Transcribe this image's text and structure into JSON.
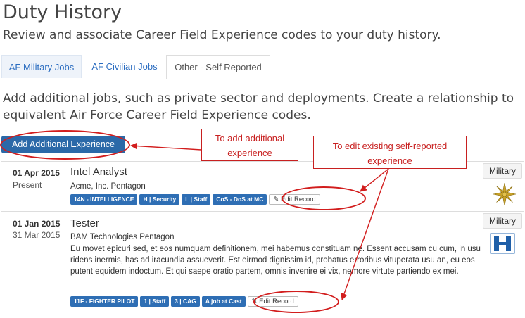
{
  "page": {
    "title": "Duty History",
    "subtitle": "Review and associate Career Field Experience codes to your duty history."
  },
  "tabs": [
    {
      "label": "AF Military Jobs"
    },
    {
      "label": "AF Civilian Jobs"
    },
    {
      "label": "Other - Self Reported"
    }
  ],
  "intro": "Add additional jobs, such as private sector and deployments. Create a relationship to equivalent Air Force Career Field Experience codes.",
  "add_button": "Add Additional Experience",
  "annotations": {
    "add_callout": "To add additional experience",
    "edit_callout": "To edit existing self-reported experience"
  },
  "records": [
    {
      "start": "01 Apr 2015",
      "end": "Present",
      "title": "Intel Analyst",
      "org": "Acme, Inc. Pentagon",
      "description": "",
      "tags": [
        "14N - INTELLIGENCE",
        "H | Security",
        "L | Staff",
        "CoS - DoS at MC"
      ],
      "edit_label": "Edit Record",
      "badge": "Military",
      "icon": "gold-star-insignia-icon"
    },
    {
      "start": "01 Jan 2015",
      "end": "31 Mar 2015",
      "title": "Tester",
      "org": "BAM Technologies Pentagon",
      "description": "Eu movet epicuri sed, et eos numquam definitionem, mei habemus constituam ne. Essent accusam cu cum, in usu ridens inermis, has ad iracundia assueverit. Est eirmod dignissim id, probatus erroribus vituperata usu an, eu eos putent equidem indoctum. Et qui saepe oratio partem, omnis invenire ei vix, nemore virtute partiendo ex mei.",
      "tags": [
        "11F - FIGHTER PILOT",
        "1 | Staff",
        "3 | CAG",
        "A job at Cast"
      ],
      "edit_label": "Edit Record",
      "badge": "Military",
      "icon": "blue-rank-bars-icon"
    }
  ],
  "colors": {
    "accent": "#2b69a8",
    "tag": "#2e6eb4",
    "annotation": "#c82020",
    "tab_link": "#2a6cc0"
  }
}
